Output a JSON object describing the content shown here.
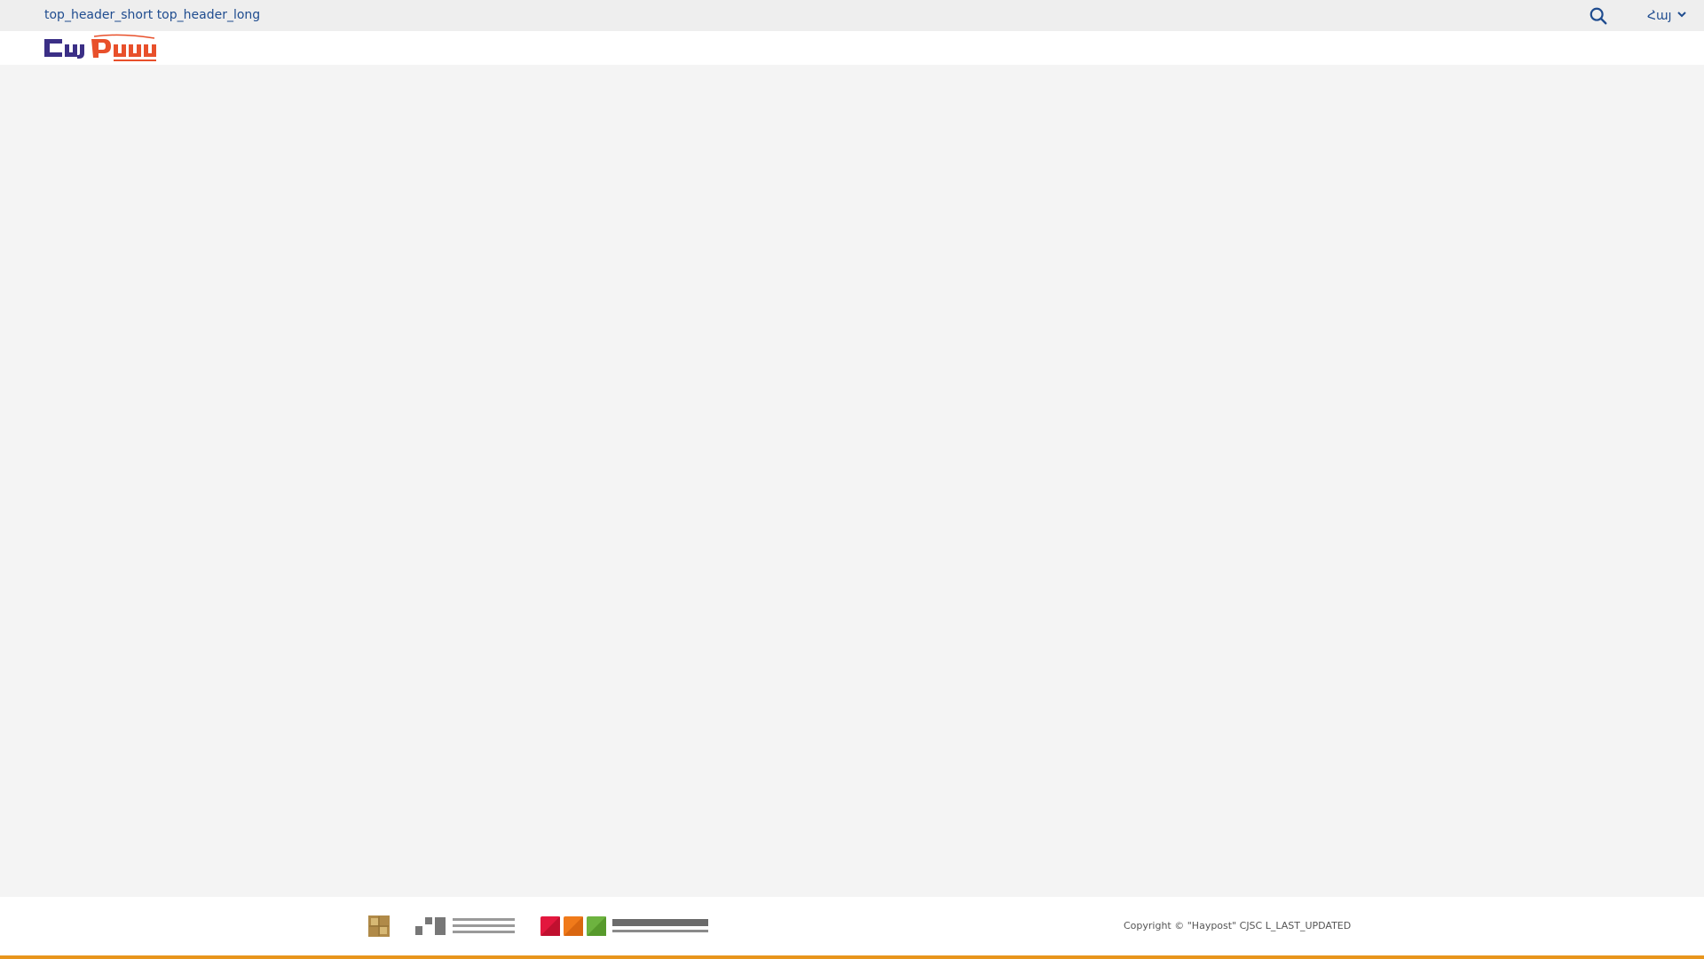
{
  "top_header": {
    "text": "top_header_short top_header_long",
    "language": "Հայ"
  },
  "icons": {
    "search": "search-icon",
    "chevron": "chevron-down-icon"
  },
  "footer": {
    "copyright": "Copyright © \"Haypost\" CJSC  L_LAST_UPDATED"
  },
  "colors": {
    "brand_blue": "#3b2f86",
    "brand_orange": "#e8502b",
    "footer_accent": "#e8951c",
    "link": "#1f4c8f"
  }
}
